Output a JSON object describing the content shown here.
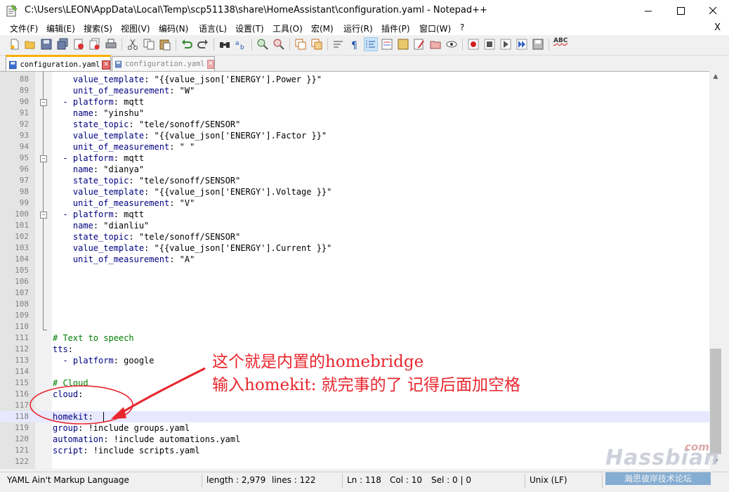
{
  "window": {
    "title": "C:\\Users\\LEON\\AppData\\Local\\Temp\\scp51138\\share\\HomeAssistant\\configuration.yaml - Notepad++",
    "minimize": "—",
    "maximize": "☐",
    "close": "✕"
  },
  "menu": {
    "items": [
      "文件(F)",
      "编辑(E)",
      "搜索(S)",
      "视图(V)",
      "编码(N)",
      "语言(L)",
      "设置(T)",
      "工具(O)",
      "宏(M)",
      "运行(R)",
      "插件(P)",
      "窗口(W)",
      "?"
    ],
    "close": "X"
  },
  "toolbar": {
    "spellcheck_label": "ABC"
  },
  "tabs": [
    {
      "label": "configuration.yaml",
      "active": true
    },
    {
      "label": "configuration.yaml",
      "active": false
    }
  ],
  "editor": {
    "current_line": 118,
    "lines": [
      {
        "n": "88",
        "indent": "    ",
        "key": "value_template",
        "rest": ": \"{{value_json['ENERGY'].Power }}\""
      },
      {
        "n": "89",
        "indent": "    ",
        "key": "unit_of_measurement",
        "rest": ": \"W\""
      },
      {
        "n": "90",
        "indent": "  - ",
        "key": "platform",
        "rest": ": mqtt",
        "fold": true
      },
      {
        "n": "91",
        "indent": "    ",
        "key": "name",
        "rest": ": \"yinshu\""
      },
      {
        "n": "92",
        "indent": "    ",
        "key": "state_topic",
        "rest": ": \"tele/sonoff/SENSOR\""
      },
      {
        "n": "93",
        "indent": "    ",
        "key": "value_template",
        "rest": ": \"{{value_json['ENERGY'].Factor }}\""
      },
      {
        "n": "94",
        "indent": "    ",
        "key": "unit_of_measurement",
        "rest": ": \" \""
      },
      {
        "n": "95",
        "indent": "  - ",
        "key": "platform",
        "rest": ": mqtt",
        "fold": true
      },
      {
        "n": "96",
        "indent": "    ",
        "key": "name",
        "rest": ": \"dianya\""
      },
      {
        "n": "97",
        "indent": "    ",
        "key": "state_topic",
        "rest": ": \"tele/sonoff/SENSOR\""
      },
      {
        "n": "98",
        "indent": "    ",
        "key": "value_template",
        "rest": ": \"{{value_json['ENERGY'].Voltage }}\""
      },
      {
        "n": "99",
        "indent": "    ",
        "key": "unit_of_measurement",
        "rest": ": \"V\""
      },
      {
        "n": "100",
        "indent": "  - ",
        "key": "platform",
        "rest": ": mqtt",
        "fold": true
      },
      {
        "n": "101",
        "indent": "    ",
        "key": "name",
        "rest": ": \"dianliu\""
      },
      {
        "n": "102",
        "indent": "    ",
        "key": "state_topic",
        "rest": ": \"tele/sonoff/SENSOR\""
      },
      {
        "n": "103",
        "indent": "    ",
        "key": "value_template",
        "rest": ": \"{{value_json['ENERGY'].Current }}\""
      },
      {
        "n": "104",
        "indent": "    ",
        "key": "unit_of_measurement",
        "rest": ": \"A\""
      },
      {
        "n": "105",
        "indent": "",
        "key": "",
        "rest": ""
      },
      {
        "n": "106",
        "indent": "",
        "key": "",
        "rest": ""
      },
      {
        "n": "107",
        "indent": "",
        "key": "",
        "rest": ""
      },
      {
        "n": "108",
        "indent": "",
        "key": "",
        "rest": ""
      },
      {
        "n": "109",
        "indent": "",
        "key": "",
        "rest": ""
      },
      {
        "n": "110",
        "indent": "",
        "key": "",
        "rest": ""
      },
      {
        "n": "111",
        "indent": "",
        "key": "",
        "rest": "",
        "comment": "# Text to speech"
      },
      {
        "n": "112",
        "indent": "",
        "key": "tts",
        "rest": ":"
      },
      {
        "n": "113",
        "indent": "  - ",
        "key": "platform",
        "rest": ": google"
      },
      {
        "n": "114",
        "indent": "",
        "key": "",
        "rest": ""
      },
      {
        "n": "115",
        "indent": "",
        "key": "",
        "rest": "",
        "comment": "# Cloud"
      },
      {
        "n": "116",
        "indent": "",
        "key": "cloud",
        "rest": ":"
      },
      {
        "n": "117",
        "indent": "",
        "key": "",
        "rest": ""
      },
      {
        "n": "118",
        "indent": "",
        "key": "homekit",
        "rest": ": "
      },
      {
        "n": "119",
        "indent": "",
        "key": "group",
        "rest": ": !include groups.yaml"
      },
      {
        "n": "120",
        "indent": "",
        "key": "automation",
        "rest": ": !include automations.yaml"
      },
      {
        "n": "121",
        "indent": "",
        "key": "script",
        "rest": ": !include scripts.yaml"
      },
      {
        "n": "122",
        "indent": "",
        "key": "",
        "rest": ""
      }
    ]
  },
  "annotation": {
    "line1": "这个就是内置的homebridge",
    "line2": "输入homekit: 就完事的了 记得后面加空格",
    "color": "#e8262d"
  },
  "status": {
    "language": "YAML Ain't Markup Language",
    "length": "length : 2,979",
    "lines": "lines : 122",
    "ln": "Ln : 118",
    "col": "Col : 10",
    "sel": "Sel : 0 | 0",
    "eol": "Unix (LF)"
  },
  "watermark": {
    "logo": "Hassbian",
    "com": "com",
    "sub": "瀚思彼岸技术论坛"
  }
}
